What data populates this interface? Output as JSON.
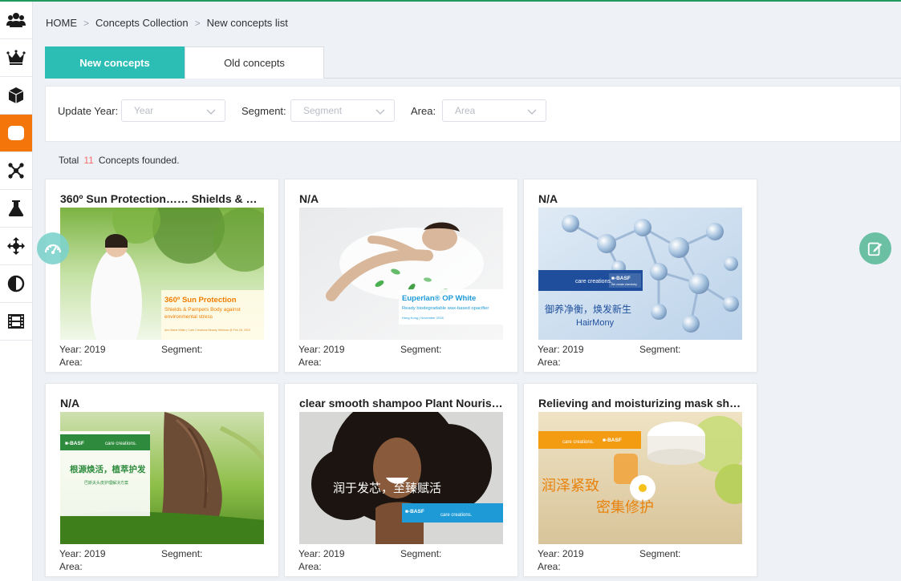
{
  "sidebar": {
    "items": [
      {
        "icon": "users-icon"
      },
      {
        "icon": "crown-icon"
      },
      {
        "icon": "cube-icon"
      },
      {
        "icon": "database-icon",
        "active": true
      },
      {
        "icon": "network-icon"
      },
      {
        "icon": "flask-icon"
      },
      {
        "icon": "move-arrows-icon"
      },
      {
        "icon": "contrast-icon"
      },
      {
        "icon": "film-icon"
      }
    ],
    "active_color": "#f4760b"
  },
  "breadcrumb": {
    "home": "HOME",
    "separator": ">",
    "level1": "Concepts Collection",
    "level2": "New concepts list"
  },
  "tabs": {
    "new_label": "New concepts",
    "old_label": "Old concepts",
    "active_color": "#2cbdb5"
  },
  "filters": {
    "year_label": "Update Year:",
    "year_placeholder": "Year",
    "segment_label": "Segment:",
    "segment_placeholder": "Segment",
    "area_label": "Area:",
    "area_placeholder": "Area"
  },
  "summary": {
    "prefix": "Total",
    "count": "11",
    "suffix": "Concepts founded."
  },
  "cards": [
    {
      "title": "360º Sun Protection…… Shields & …",
      "year": "Year: 2019",
      "segment": "Segment:",
      "area": "Area:",
      "image": {
        "overlay_title": "360º Sun Protection",
        "overlay_sub1": "Shields & Pampers Body against",
        "overlay_sub2": "environmental stress",
        "overlay_foot": "Ann Marie Walte | Care Creations Beauty Webinar @ Feb 28, 2019"
      }
    },
    {
      "title": "N/A",
      "year": "Year: 2019",
      "segment": "Segment:",
      "area": "Area:",
      "image": {
        "overlay_title": "Euperlan® OP White",
        "overlay_sub1": "Ready biodegradable wax-based opacifier",
        "overlay_foot": "Hong Kong | November 2018"
      }
    },
    {
      "title": "N/A",
      "year": "Year: 2019",
      "segment": "Segment:",
      "area": "Area:",
      "image": {
        "brand1": "care creations.",
        "brand2": "■-BASF",
        "brand_sub": "We create chemistry",
        "caption_cn": "御养净衡，焕发新生",
        "caption_en": "HairMony"
      }
    },
    {
      "title": "N/A",
      "year": "Year: 2019",
      "segment": "Segment:",
      "area": "Area:",
      "image": {
        "brand1": "■-BASF",
        "brand2": "care creations.",
        "caption_cn": "根源焕活，植萃护发",
        "caption_sub": "巴斯夫头皮护理解决方案"
      }
    },
    {
      "title": "clear smooth shampoo Plant Nourishing",
      "year": "Year: 2019",
      "segment": "Segment:",
      "area": "Area:",
      "image": {
        "caption_cn": "润于发芯，至臻赋活",
        "brand1": "■-BASF",
        "brand2": "care creations."
      }
    },
    {
      "title": "Relieving and moisturizing mask sheet",
      "year": "Year: 2019",
      "segment": "Segment:",
      "area": "Area:",
      "image": {
        "brand1": "care creations.",
        "brand2": "■-BASF",
        "caption_cn1": "润泽紧致",
        "caption_cn2": "密集修护"
      }
    }
  ],
  "floating": {
    "left_icon": "dashboard-gauge-icon",
    "right_icon": "edit-note-icon"
  }
}
